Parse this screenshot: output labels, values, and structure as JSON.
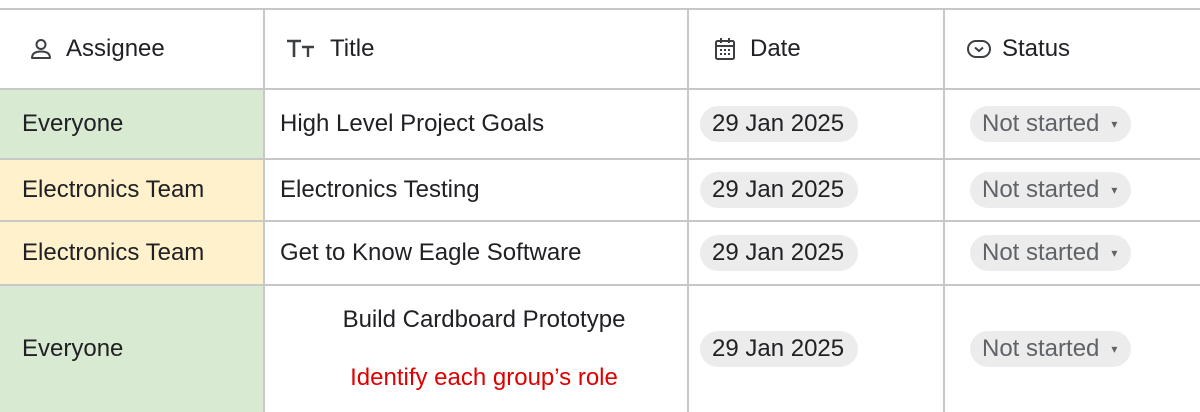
{
  "header": {
    "assignee": "Assignee",
    "title": "Title",
    "date": "Date",
    "status": "Status"
  },
  "icons": {
    "assignee": "person-icon",
    "title": "text-tt-icon",
    "date": "calendar-icon",
    "status": "status-chip-icon",
    "dropdown": "caret-down-icon"
  },
  "colors": {
    "everyone_bg": "#d9ead3",
    "electronics_bg": "#fff1cc",
    "note_red": "#e00000",
    "chip_bg": "#ececec",
    "grid": "#c8c8c8"
  },
  "rows": [
    {
      "assignee": "Everyone",
      "title": "High Level Project Goals",
      "date": "29 Jan 2025",
      "status": "Not started"
    },
    {
      "assignee": "Electronics Team",
      "title": "Electronics Testing",
      "date": "29 Jan 2025",
      "status": "Not started"
    },
    {
      "assignee": "Electronics Team",
      "title": "Get to Know Eagle Software",
      "date": "29 Jan 2025",
      "status": "Not started"
    },
    {
      "assignee": "Everyone",
      "title": "Build Cardboard Prototype",
      "note": "Identify each group’s role",
      "date": "29 Jan 2025",
      "status": "Not started"
    }
  ]
}
